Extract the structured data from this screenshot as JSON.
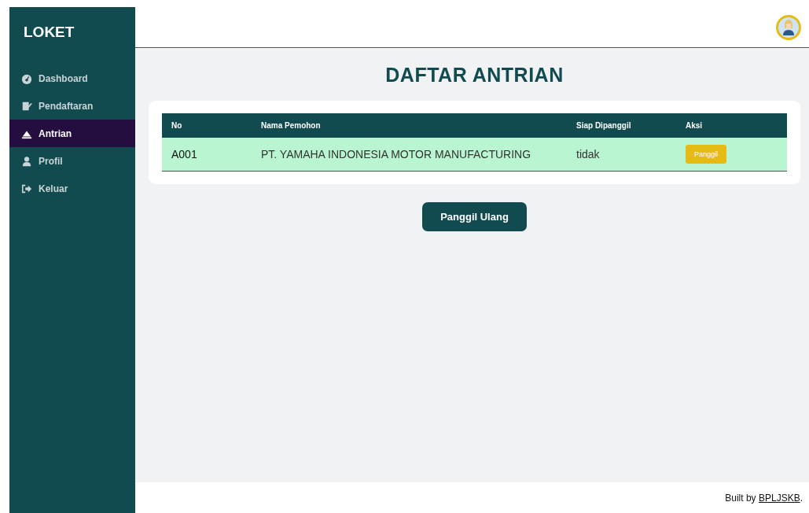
{
  "sidebar": {
    "brand": "LOKET",
    "items": [
      {
        "label": "Dashboard",
        "selected": false
      },
      {
        "label": "Pendaftaran",
        "selected": false
      },
      {
        "label": "Antrian",
        "selected": true
      },
      {
        "label": "Profil",
        "selected": false
      },
      {
        "label": "Keluar",
        "selected": false
      }
    ]
  },
  "page": {
    "title": "DAFTAR ANTRIAN"
  },
  "table": {
    "columns": [
      "No",
      "Nama Pemohon",
      "Siap Dipanggil",
      "Aksi"
    ],
    "rows": [
      {
        "no": "A001",
        "name": "PT. YAMAHA INDONESIA MOTOR MANUFACTURING",
        "ready": "tidak",
        "action": "Panggil"
      }
    ]
  },
  "recall_button": "Panggil Ulang",
  "footer": {
    "text": "Built by",
    "link": "BPLJSKB",
    "suffix": "."
  }
}
